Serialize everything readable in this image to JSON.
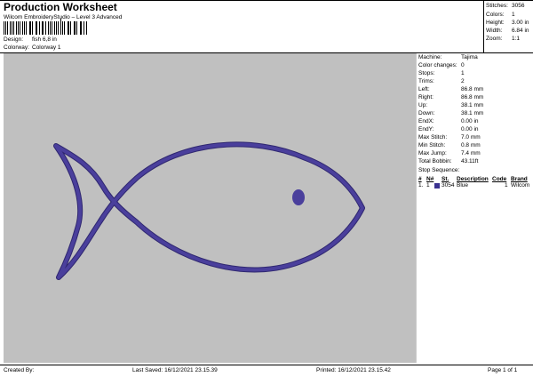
{
  "header": {
    "title": "Production Worksheet",
    "subtitle": "Wilcom EmbroideryStudio – Level 3 Advanced"
  },
  "design_info": [
    {
      "label": "Design:",
      "value": "fish 6,8 in"
    },
    {
      "label": "Colorway:",
      "value": "Colorway 1"
    }
  ],
  "top_stats": [
    {
      "label": "Stitches:",
      "value": "3056"
    },
    {
      "label": "Colors:",
      "value": "1"
    },
    {
      "label": "Height:",
      "value": "3.00 in"
    },
    {
      "label": "Width:",
      "value": "6.84 in"
    },
    {
      "label": "Zoom:",
      "value": "1:1"
    }
  ],
  "machine_stats": [
    {
      "label": "Machine:",
      "value": "Tajima"
    },
    {
      "label": "Color changes:",
      "value": "0"
    },
    {
      "label": "Stops:",
      "value": "1"
    },
    {
      "label": "Trims:",
      "value": "2"
    },
    {
      "label": "Left:",
      "value": "86.8 mm"
    },
    {
      "label": "Right:",
      "value": "86.8 mm"
    },
    {
      "label": "Up:",
      "value": "38.1 mm"
    },
    {
      "label": "Down:",
      "value": "38.1 mm"
    },
    {
      "label": "EndX:",
      "value": "0.00 in"
    },
    {
      "label": "EndY:",
      "value": "0.00 in"
    },
    {
      "label": "Max Stitch:",
      "value": "7.0 mm"
    },
    {
      "label": "Min Stitch:",
      "value": "0.8 mm"
    },
    {
      "label": "Max Jump:",
      "value": "7.4 mm"
    },
    {
      "label": "Total Bobbin:",
      "value": "43.11ft"
    }
  ],
  "stop_sequence": {
    "title": "Stop Sequence:",
    "headers": {
      "num": "#",
      "n": "N#",
      "st": "St.",
      "description": "Description",
      "code": "Code",
      "brand": "Brand"
    },
    "rows": [
      {
        "num": "1.",
        "n": "1",
        "st": "3054",
        "description": "Blue",
        "code": "1",
        "brand": "Wilcom",
        "color": "#3a3190"
      }
    ]
  },
  "design_color": "#4a3f9c",
  "footer": {
    "created_by": "Created By:",
    "last_saved": "Last Saved: 16/12/2021 23.15.39",
    "printed": "Printed: 16/12/2021 23.15.42",
    "page": "Page 1 of 1"
  }
}
